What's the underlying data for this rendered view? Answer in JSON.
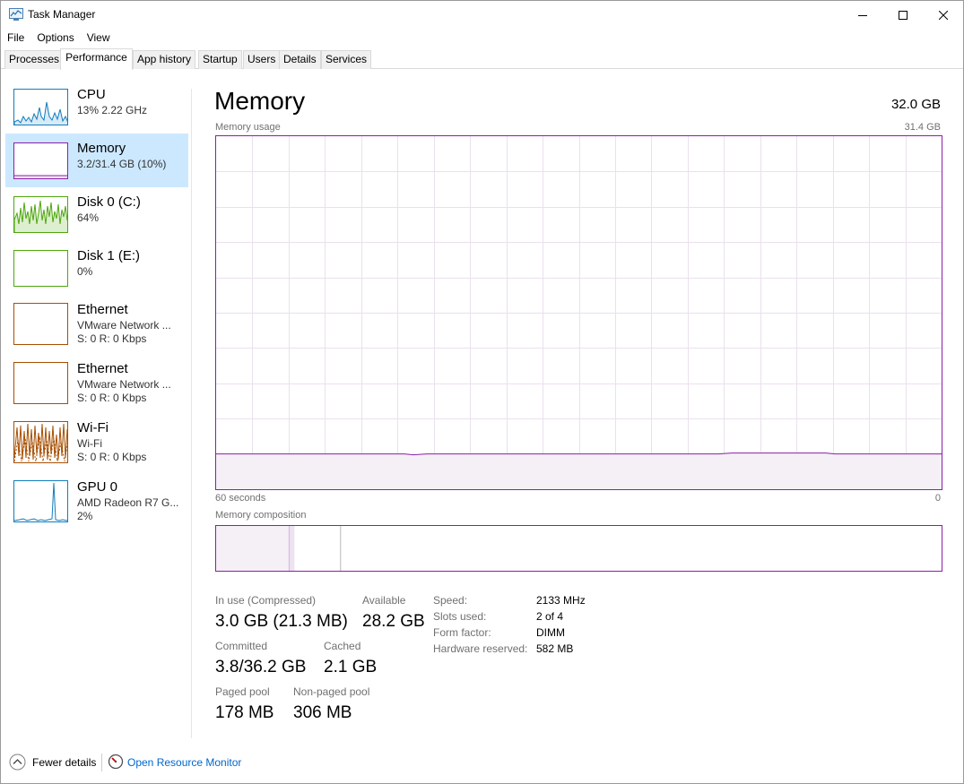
{
  "window": {
    "title": "Task Manager"
  },
  "menu": [
    "File",
    "Options",
    "View"
  ],
  "tabs": [
    "Processes",
    "Performance",
    "App history",
    "Startup",
    "Users",
    "Details",
    "Services"
  ],
  "active_tab": "Performance",
  "sidebar": [
    {
      "title": "CPU",
      "sub": "13%  2.22 GHz",
      "sub2": "",
      "color": "#117dbb"
    },
    {
      "title": "Memory",
      "sub": "3.2/31.4 GB (10%)",
      "sub2": "",
      "color": "#8b1fa8",
      "selected": true
    },
    {
      "title": "Disk 0 (C:)",
      "sub": "64%",
      "sub2": "",
      "color": "#4da60c"
    },
    {
      "title": "Disk 1 (E:)",
      "sub": "0%",
      "sub2": "",
      "color": "#4da60c"
    },
    {
      "title": "Ethernet",
      "sub": "VMware Network ...",
      "sub2": "S: 0  R: 0 Kbps",
      "color": "#a74f01"
    },
    {
      "title": "Ethernet",
      "sub": "VMware Network ...",
      "sub2": "S: 0  R: 0 Kbps",
      "color": "#a74f01"
    },
    {
      "title": "Wi-Fi",
      "sub": "Wi-Fi",
      "sub2": "S: 0  R: 0 Kbps",
      "color": "#a74f01"
    },
    {
      "title": "GPU 0",
      "sub": "AMD Radeon R7 G...",
      "sub2": "2%",
      "color": "#117dbb"
    }
  ],
  "main": {
    "title": "Memory",
    "total": "32.0 GB",
    "usage_label": "Memory usage",
    "usage_max": "31.4 GB",
    "time_left": "60 seconds",
    "time_right": "0",
    "composition_label": "Memory composition",
    "usage_fraction": 0.1,
    "composition": {
      "in_use_fraction": 0.1,
      "modified_fraction": 0.008,
      "standby_fraction": 0.063
    }
  },
  "stats": {
    "in_use_label": "In use (Compressed)",
    "in_use_value": "3.0 GB (21.3 MB)",
    "available_label": "Available",
    "available_value": "28.2 GB",
    "committed_label": "Committed",
    "committed_value": "3.8/36.2 GB",
    "cached_label": "Cached",
    "cached_value": "2.1 GB",
    "paged_label": "Paged pool",
    "paged_value": "178 MB",
    "nonpaged_label": "Non-paged pool",
    "nonpaged_value": "306 MB"
  },
  "specs": [
    {
      "label": "Speed:",
      "value": "2133 MHz"
    },
    {
      "label": "Slots used:",
      "value": "2 of 4"
    },
    {
      "label": "Form factor:",
      "value": "DIMM"
    },
    {
      "label": "Hardware reserved:",
      "value": "582 MB"
    }
  ],
  "footer": {
    "fewer_details": "Fewer details",
    "open_resource_monitor": "Open Resource Monitor"
  },
  "colors": {
    "memory": "#8b1fa8",
    "selection": "#cce8ff",
    "link": "#0066cc"
  }
}
